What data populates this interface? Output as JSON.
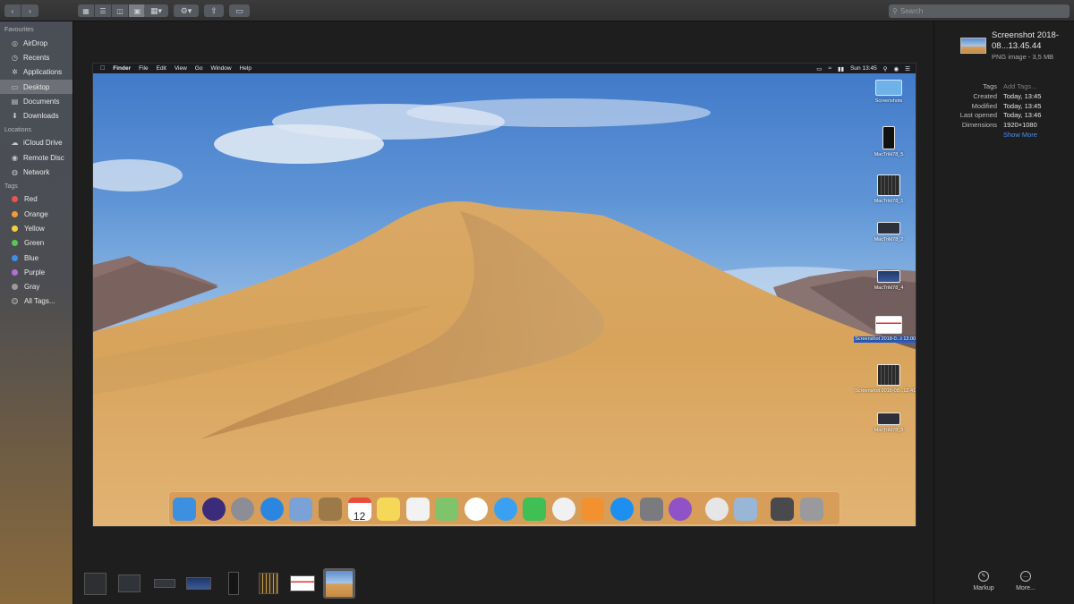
{
  "toolbar": {
    "back_icon": "chevron-left-icon",
    "forward_icon": "chevron-right-icon",
    "view_modes": [
      "icon-view",
      "list-view",
      "column-view",
      "gallery-view"
    ],
    "search_placeholder": "Search"
  },
  "sidebar": {
    "favourites_header": "Favourites",
    "favourites": [
      {
        "label": "AirDrop",
        "icon": "airdrop-icon"
      },
      {
        "label": "Recents",
        "icon": "clock-icon"
      },
      {
        "label": "Applications",
        "icon": "applications-icon"
      },
      {
        "label": "Desktop",
        "icon": "desktop-icon",
        "selected": true
      },
      {
        "label": "Documents",
        "icon": "document-icon"
      },
      {
        "label": "Downloads",
        "icon": "download-icon"
      }
    ],
    "locations_header": "Locations",
    "locations": [
      {
        "label": "iCloud Drive",
        "icon": "cloud-icon"
      },
      {
        "label": "Remote Disc",
        "icon": "disc-icon"
      },
      {
        "label": "Network",
        "icon": "globe-icon"
      }
    ],
    "tags_header": "Tags",
    "tags": [
      {
        "label": "Red",
        "color": "#e8554f"
      },
      {
        "label": "Orange",
        "color": "#f29a38"
      },
      {
        "label": "Yellow",
        "color": "#f2d03d"
      },
      {
        "label": "Green",
        "color": "#5cc653"
      },
      {
        "label": "Blue",
        "color": "#3e8fe8"
      },
      {
        "label": "Purple",
        "color": "#b36fd6"
      },
      {
        "label": "Gray",
        "color": "#9a9a9a"
      },
      {
        "label": "All Tags...",
        "color": "all"
      }
    ]
  },
  "preview": {
    "menubar": {
      "items": [
        "Finder",
        "File",
        "Edit",
        "View",
        "Go",
        "Window",
        "Help"
      ],
      "clock": "Sun 13:45"
    },
    "desktop_icons": [
      {
        "label": "Screenshots",
        "kind": "folder"
      },
      {
        "label": "MacTrikl78_5",
        "kind": "phone"
      },
      {
        "label": "MacTrikl78_1",
        "kind": "grid"
      },
      {
        "label": "MacTrikl78_2",
        "kind": "dark"
      },
      {
        "label": "MacTrikl78_4",
        "kind": "wallpaper"
      },
      {
        "label": "Screenshot 2018-0...t 13.00.27",
        "kind": "page",
        "selected": true
      },
      {
        "label": "Screenshot 2018-08...12.41.21",
        "kind": "grid"
      },
      {
        "label": "MacTrikl78_3",
        "kind": "dark"
      }
    ],
    "dock_apps": [
      "finder",
      "siri",
      "launchpad",
      "safari",
      "mail",
      "contacts",
      "calendar",
      "notes",
      "reminders",
      "maps",
      "photos",
      "messages",
      "facetime",
      "itunes",
      "ibooks",
      "app-store",
      "system-preferences",
      "feedback",
      "chrome",
      "preview",
      "downloads-stack",
      "trash"
    ],
    "calendar_day": "12"
  },
  "inspector": {
    "file_name": "Screenshot 2018-08...13.45.44",
    "file_kind": "PNG image - 3,5 MB",
    "rows": [
      {
        "key": "Tags",
        "value": "Add Tags...",
        "style": "dim"
      },
      {
        "key": "Created",
        "value": "Today, 13:45"
      },
      {
        "key": "Modified",
        "value": "Today, 13:45"
      },
      {
        "key": "Last opened",
        "value": "Today, 13:46"
      },
      {
        "key": "Dimensions",
        "value": "1920×1080"
      }
    ],
    "show_more": "Show More",
    "markup_label": "Markup",
    "more_label": "More..."
  },
  "filmstrip": {
    "selected_index": 7
  }
}
